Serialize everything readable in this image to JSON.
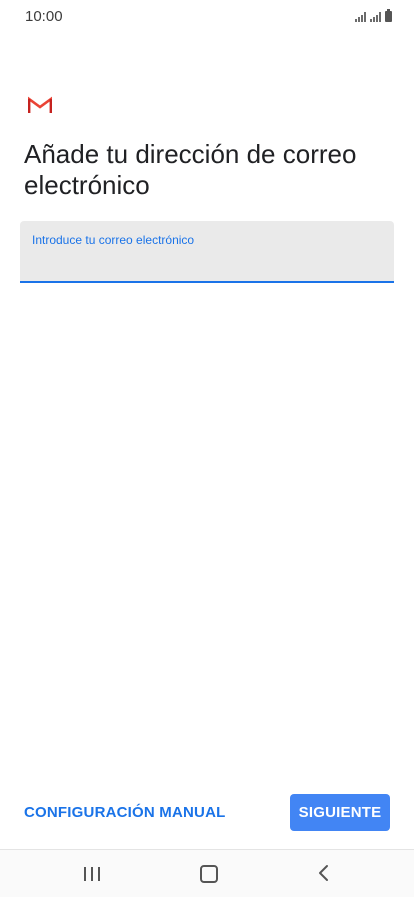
{
  "status_bar": {
    "time": "10:00",
    "icons": [
      "signal-icon",
      "signal-icon",
      "battery-icon"
    ]
  },
  "app": {
    "logo": "gmail-logo",
    "colors": {
      "accent": "#1a73e8",
      "button_bg": "#4285f4",
      "logo_red": "#ea4335"
    }
  },
  "main": {
    "title": "Añade tu dirección de correo electrónico",
    "email_field": {
      "label": "Introduce tu correo electrónico",
      "value": ""
    }
  },
  "footer": {
    "manual_label": "CONFIGURACIÓN MANUAL",
    "next_label": "SIGUIENTE"
  },
  "nav_bar": {
    "buttons": [
      "recent-apps-icon",
      "home-icon",
      "back-icon"
    ]
  }
}
